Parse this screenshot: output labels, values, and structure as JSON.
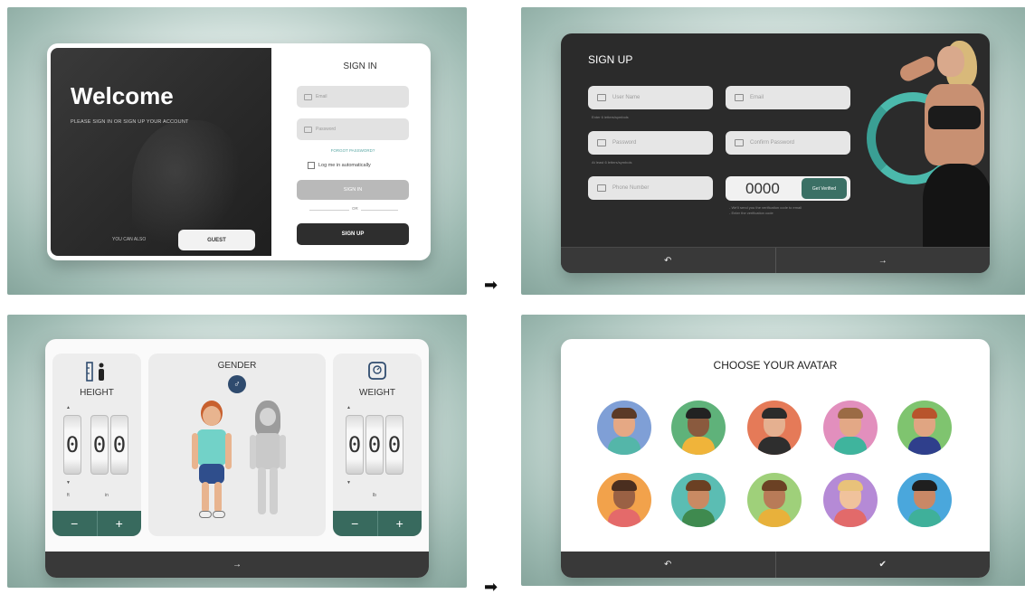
{
  "q1": {
    "welcome_title": "Welcome",
    "welcome_subtitle": "PLEASE SIGN IN OR SIGN UP YOUR ACCOUNT",
    "guest_prompt": "YOU CAN ALSO",
    "guest_button": "GUEST",
    "signin_title": "SIGN IN",
    "email_placeholder": "Email",
    "password_placeholder": "Password",
    "forgot_password": "FORGOT PASSWORD?",
    "remember_label": "Log me in automatically",
    "signin_button": "SIGN IN",
    "or_label": "OR",
    "signup_button": "SIGN UP"
  },
  "q2": {
    "title": "SIGN UP",
    "username_placeholder": "User Name",
    "username_hint": "Enter 6 letters/symbols",
    "email_placeholder": "Email",
    "password_placeholder": "Password",
    "password_hint": "At least 6 letters/symbols",
    "confirm_placeholder": "Confirm Password",
    "phone_placeholder": "Phone Number",
    "code_value": "0000",
    "get_verified_button": "Get Verified",
    "verify_hint_1": "- We'll send you the verification code to email",
    "verify_hint_2": "- Enter the verification code",
    "back_icon": "↶",
    "next_icon": "→"
  },
  "q3": {
    "height_label": "HEIGHT",
    "height_digits": [
      "0",
      "0",
      "0"
    ],
    "height_unit_1": "ft",
    "height_unit_2": "in",
    "gender_label": "GENDER",
    "gender_symbol": "♂",
    "weight_label": "WEIGHT",
    "weight_digits": [
      "0",
      "0",
      "0"
    ],
    "weight_unit": "lb",
    "minus": "−",
    "plus": "+",
    "up_marker": "▲",
    "down_marker": "▼",
    "next_icon": "→"
  },
  "q4": {
    "title": "CHOOSE YOUR AVATAR",
    "back_icon": "↶",
    "confirm_icon": "✔"
  },
  "flow_arrow": "➡",
  "colors": {
    "accent_green": "#386a5e",
    "teal": "#4bb9ac",
    "dark": "#2b2b2b"
  }
}
